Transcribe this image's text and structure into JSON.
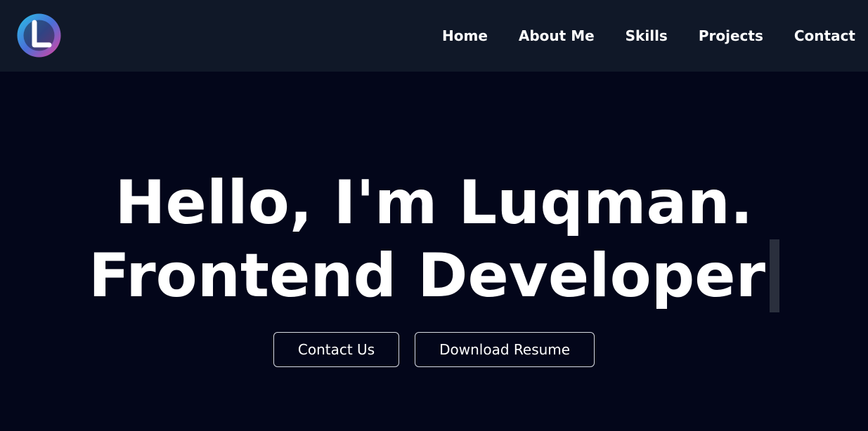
{
  "colors": {
    "navbar_bg": "#101828",
    "page_bg": "#03061a",
    "text": "#ffffff",
    "cursor": "#2a2f3d",
    "button_border": "#d8dbe2",
    "logo_gradient_start": "#28c3e6",
    "logo_gradient_end": "#e2409c"
  },
  "nav": {
    "logo_icon": "L-logo-icon",
    "links": [
      {
        "label": "Home"
      },
      {
        "label": "About Me"
      },
      {
        "label": "Skills"
      },
      {
        "label": "Projects"
      },
      {
        "label": "Contact"
      }
    ]
  },
  "hero": {
    "line1": "Hello, I'm Luqman.",
    "line2": "Frontend Developer",
    "buttons": {
      "contact_label": "Contact Us",
      "resume_label": "Download Resume"
    }
  }
}
